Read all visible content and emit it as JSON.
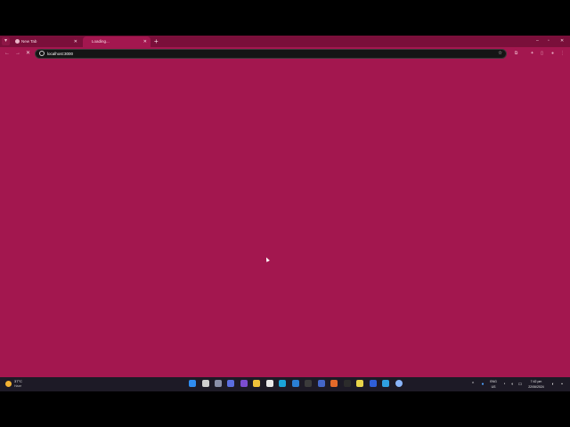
{
  "browser": {
    "tabs": [
      {
        "title": "New Tab",
        "active": false
      },
      {
        "title": "Loading...",
        "active": true
      }
    ],
    "new_tab_label": "+",
    "url": "localhost:3000",
    "theme_color": "#a3174f",
    "frame_color": "#7a0f3a"
  },
  "taskbar": {
    "weather": {
      "temp": "37°C",
      "desc": "Haze"
    },
    "language": {
      "line1": "ENG",
      "line2": "US"
    },
    "clock": {
      "time": "7:42 pm",
      "date": "22/06/2024"
    },
    "apps": [
      "windows-start",
      "search",
      "task-view",
      "widgets",
      "visual-studio",
      "file-explorer",
      "store",
      "edge",
      "chrome",
      "terminal",
      "settings",
      "notepad",
      "figma",
      "photoshop",
      "vscode",
      "tool",
      "chrome-active"
    ]
  }
}
